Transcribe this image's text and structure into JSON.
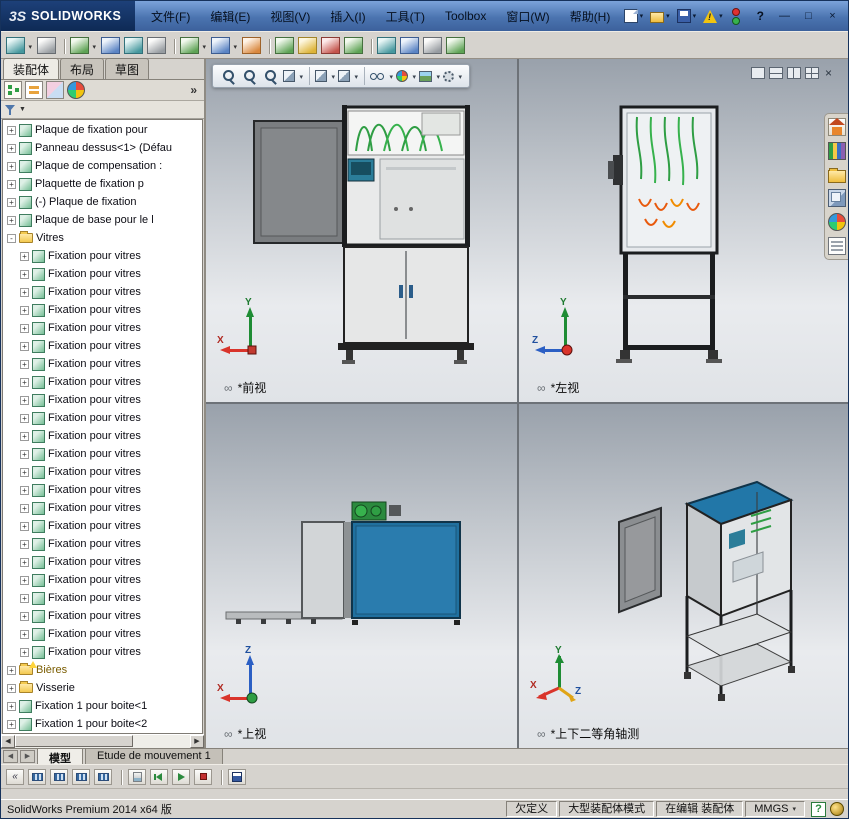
{
  "window": {
    "logo_mark": "3S",
    "logo_text": "SOLIDWORKS",
    "menus": [
      "文件(F)",
      "编辑(E)",
      "视图(V)",
      "插入(I)",
      "工具(T)",
      "Toolbox",
      "窗口(W)",
      "帮助(H)"
    ],
    "quick_icons": [
      {
        "name": "new-document-icon",
        "k": "page"
      },
      {
        "name": "open-document-icon",
        "k": "folder"
      },
      {
        "name": "save-icon",
        "k": "disk"
      },
      {
        "name": "report-alert-icon",
        "k": "alert"
      }
    ],
    "help_label": "?",
    "controls": {
      "minimize": "—",
      "maximize": "□",
      "close": "×"
    }
  },
  "toolbar": {
    "icons": [
      {
        "name": "insert-components-icon",
        "tone": "teal",
        "caret": true
      },
      {
        "name": "mate-icon",
        "tone": "gray"
      },
      {
        "name": "linear-component-pattern-icon",
        "tone": "green",
        "caret": true,
        "gap": true
      },
      {
        "name": "smart-fasteners-icon",
        "tone": "blue"
      },
      {
        "name": "move-component-icon",
        "tone": "teal"
      },
      {
        "name": "show-hidden-components-icon",
        "tone": "gray"
      },
      {
        "name": "assembly-features-icon",
        "tone": "green",
        "caret": true,
        "gap": true
      },
      {
        "name": "reference-geometry-icon",
        "tone": "blue",
        "caret": true
      },
      {
        "name": "new-motion-study-icon",
        "tone": "orange"
      },
      {
        "name": "bill-of-materials-icon",
        "tone": "green",
        "gap": true
      },
      {
        "name": "exploded-view-icon",
        "tone": "yellow"
      },
      {
        "name": "interference-detection-icon",
        "tone": "red"
      },
      {
        "name": "assembly-visualization-icon",
        "tone": "green"
      },
      {
        "name": "instant3d-icon",
        "tone": "teal",
        "gap": true
      },
      {
        "name": "large-assembly-mode-icon",
        "tone": "blue"
      },
      {
        "name": "measure-icon",
        "tone": "gray"
      },
      {
        "name": "mass-properties-icon",
        "tone": "green"
      }
    ]
  },
  "left_panel": {
    "tabs": [
      {
        "label": "装配体",
        "active": true
      },
      {
        "label": "布局",
        "active": false
      },
      {
        "label": "草图",
        "active": false
      }
    ],
    "header_icons": [
      {
        "name": "featuremanager-tab-icon",
        "k": "fm"
      },
      {
        "name": "propertymanager-tab-icon",
        "k": "pm"
      },
      {
        "name": "configurationmanager-tab-icon",
        "k": "cm"
      },
      {
        "name": "displaymanager-tab-icon",
        "k": "ball"
      }
    ],
    "more_label": "»",
    "filter_caret": "▼",
    "tree": {
      "items": [
        {
          "label": "Plaque de fixation pour",
          "icon": "part",
          "indent": 0
        },
        {
          "label": "Panneau dessus<1> (Défau",
          "icon": "part",
          "indent": 0
        },
        {
          "label": "Plaque de compensation :",
          "icon": "part",
          "indent": 0
        },
        {
          "label": "Plaquette de fixation p",
          "icon": "part",
          "indent": 0
        },
        {
          "label": "(-) Plaque de fixation",
          "icon": "part",
          "indent": 0
        },
        {
          "label": "Plaque de base pour le l",
          "icon": "part",
          "indent": 0
        },
        {
          "label": "Vitres",
          "icon": "folder",
          "indent": 0,
          "exp": "-"
        },
        {
          "label": "Fixation pour vitres",
          "icon": "part",
          "indent": 1
        },
        {
          "label": "Fixation pour vitres",
          "icon": "part",
          "indent": 1
        },
        {
          "label": "Fixation pour vitres",
          "icon": "part",
          "indent": 1
        },
        {
          "label": "Fixation pour vitres",
          "icon": "part",
          "indent": 1
        },
        {
          "label": "Fixation pour vitres",
          "icon": "part",
          "indent": 1
        },
        {
          "label": "Fixation pour vitres",
          "icon": "part",
          "indent": 1
        },
        {
          "label": "Fixation pour vitres",
          "icon": "part",
          "indent": 1
        },
        {
          "label": "Fixation pour vitres",
          "icon": "part",
          "indent": 1
        },
        {
          "label": "Fixation pour vitres",
          "icon": "part",
          "indent": 1
        },
        {
          "label": "Fixation pour vitres",
          "icon": "part",
          "indent": 1
        },
        {
          "label": "Fixation pour vitres",
          "icon": "part",
          "indent": 1
        },
        {
          "label": "Fixation pour vitres",
          "icon": "part",
          "indent": 1
        },
        {
          "label": "Fixation pour vitres",
          "icon": "part",
          "indent": 1
        },
        {
          "label": "Fixation pour vitres",
          "icon": "part",
          "indent": 1
        },
        {
          "label": "Fixation pour vitres",
          "icon": "part",
          "indent": 1
        },
        {
          "label": "Fixation pour vitres",
          "icon": "part",
          "indent": 1
        },
        {
          "label": "Fixation pour vitres",
          "icon": "part",
          "indent": 1
        },
        {
          "label": "Fixation pour vitres",
          "icon": "part",
          "indent": 1
        },
        {
          "label": "Fixation pour vitres",
          "icon": "part",
          "indent": 1
        },
        {
          "label": "Fixation pour vitres",
          "icon": "part",
          "indent": 1
        },
        {
          "label": "Fixation pour vitres",
          "icon": "part",
          "indent": 1
        },
        {
          "label": "Fixation pour vitres",
          "icon": "part",
          "indent": 1
        },
        {
          "label": "Fixation pour vitres",
          "icon": "part",
          "indent": 1
        },
        {
          "label": "Bières",
          "icon": "warnfolder",
          "indent": 0
        },
        {
          "label": "Visserie",
          "icon": "folder",
          "indent": 0
        },
        {
          "label": "Fixation 1 pour boite<1",
          "icon": "part",
          "indent": 0
        },
        {
          "label": "Fixation 1 pour boite<2",
          "icon": "part",
          "indent": 0
        }
      ]
    },
    "hscroll": {
      "left": "◀",
      "right": "▶"
    }
  },
  "viewport": {
    "heads_up": [
      {
        "name": "zoom-to-fit-icon",
        "k": "mag"
      },
      {
        "name": "zoom-to-area-icon",
        "k": "mag"
      },
      {
        "name": "previous-view-icon",
        "k": "mag"
      },
      {
        "name": "section-view-icon",
        "k": "cube",
        "caret": true
      },
      {
        "name": "view-orientation-icon",
        "k": "cube",
        "caret": true,
        "gap": true
      },
      {
        "name": "display-style-icon",
        "k": "cube",
        "caret": true
      },
      {
        "name": "hide-show-items-icon",
        "k": "glasses",
        "caret": true,
        "gap": true
      },
      {
        "name": "edit-appearance-icon",
        "k": "ball",
        "caret": true
      },
      {
        "name": "apply-scene-icon",
        "k": "scene",
        "caret": true
      },
      {
        "name": "view-settings-icon",
        "k": "gear",
        "caret": true
      }
    ],
    "pane_buttons": [
      {
        "name": "viewport-single-icon",
        "k": "one"
      },
      {
        "name": "viewport-two-horizontal-icon",
        "k": "twoh"
      },
      {
        "name": "viewport-two-vertical-icon",
        "k": "twov"
      },
      {
        "name": "viewport-four-icon",
        "k": "four"
      }
    ],
    "close_glyph": "×",
    "link_glyph": "∞",
    "views": [
      {
        "label": "*前视"
      },
      {
        "label": "*左视"
      },
      {
        "label": "*上视"
      },
      {
        "label": "*上下二等角轴测"
      }
    ]
  },
  "task_pane": {
    "tabs": [
      {
        "name": "solidworks-resources-icon",
        "k": "home"
      },
      {
        "name": "design-library-icon",
        "k": "library"
      },
      {
        "name": "file-explorer-icon",
        "k": "folder"
      },
      {
        "name": "view-palette-icon",
        "k": "palette"
      },
      {
        "name": "appearances-icon",
        "k": "ball"
      },
      {
        "name": "custom-properties-icon",
        "k": "props"
      }
    ]
  },
  "motion": {
    "nav_prev": "◀",
    "nav_next": "▶",
    "tabs": [
      {
        "label": "模型",
        "active": true
      },
      {
        "label": "Etude de mouvement 1",
        "active": false
      }
    ],
    "icons": [
      {
        "name": "motionmanager-expand-icon",
        "k": "chev"
      },
      {
        "name": "filter-animation-icon",
        "k": "film"
      },
      {
        "name": "filter-driving-icon",
        "k": "film"
      },
      {
        "name": "filter-selected-icon",
        "k": "film"
      },
      {
        "name": "filter-results-icon",
        "k": "film"
      },
      {
        "name": "calculate-icon",
        "k": "calc",
        "gap": true
      },
      {
        "name": "play-from-start-icon",
        "k": "pfs"
      },
      {
        "name": "play-icon",
        "k": "play"
      },
      {
        "name": "stop-icon",
        "k": "stop"
      },
      {
        "name": "save-animation-icon",
        "k": "save",
        "gap": true
      }
    ]
  },
  "statusbar": {
    "product": "SolidWorks Premium 2014 x64 版",
    "define_state": "欠定义",
    "assembly_mode": "大型装配体模式",
    "edit_state": "在编辑 装配体",
    "units": "MMGS",
    "units_caret": "▾",
    "help_toggle": "?"
  },
  "colors": {
    "accent_blue": "#20709f",
    "tube_green": "#2f9e44",
    "tube_orange": "#e8590c",
    "titlebar_blue": "#4b74b0",
    "chrome_gray": "#d6d3ce"
  }
}
